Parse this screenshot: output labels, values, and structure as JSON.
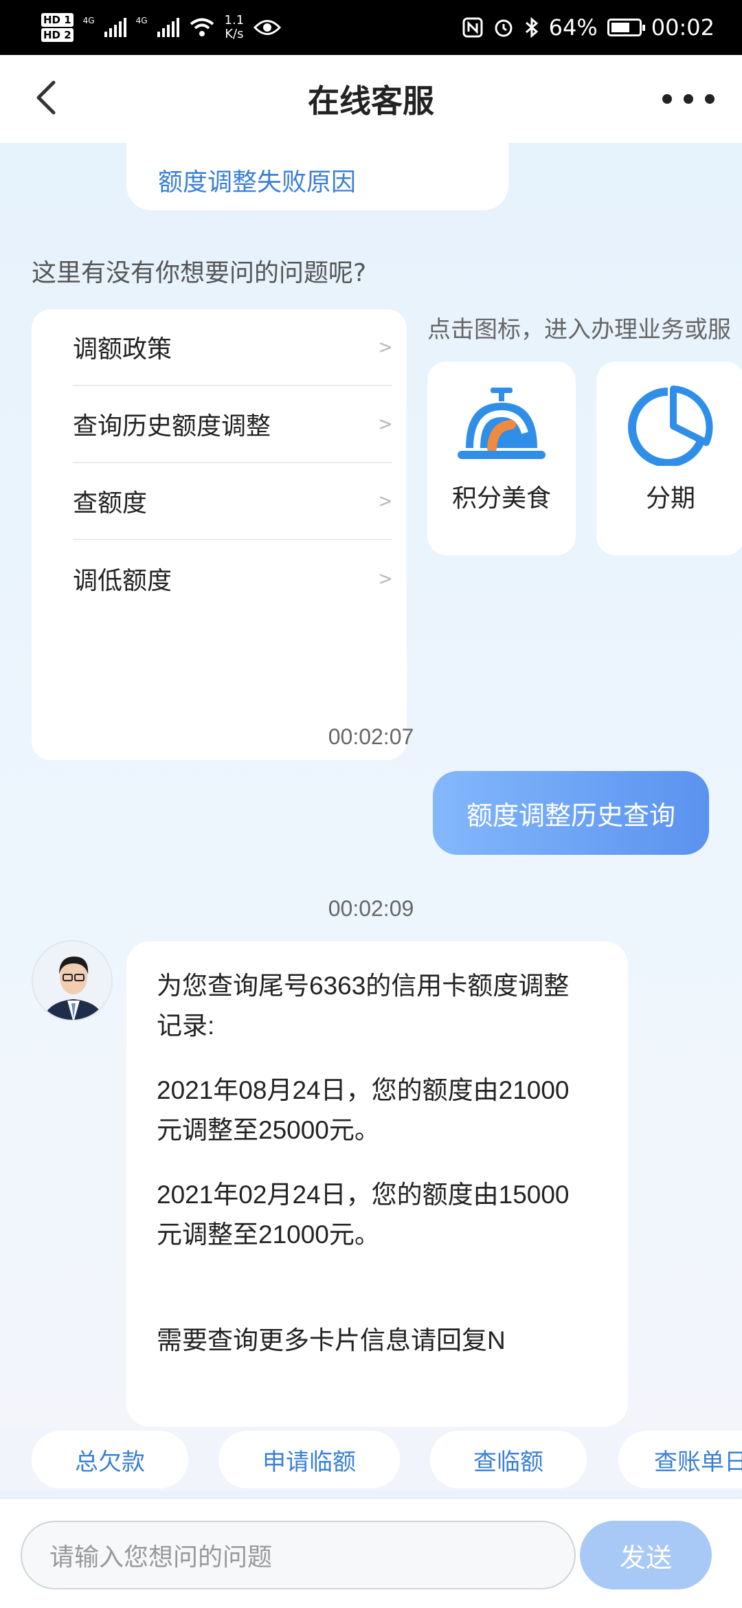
{
  "status_bar": {
    "hd1": "HD 1",
    "hd2": "HD 2",
    "net1": "4G",
    "net2": "4G",
    "speed_value": "1.1",
    "speed_unit": "K/s",
    "battery": "64%",
    "time": "00:02"
  },
  "nav": {
    "title": "在线客服"
  },
  "chat": {
    "prev_link": "额度调整失败原因",
    "question_prompt": "这里有没有你想要问的问题呢?",
    "faq_items": [
      "调额政策",
      "查询历史额度调整",
      "查额度",
      "调低额度"
    ],
    "chevron": ">",
    "service_hint": "点击图标，进入办理业务或服",
    "services": [
      {
        "label": "积分美食",
        "icon": "service-bell-icon"
      },
      {
        "label": "分期",
        "icon": "pie-chart-icon"
      }
    ],
    "timestamp_1": "00:02:07",
    "user_message": "额度调整历史查询",
    "timestamp_2": "00:02:09",
    "bot_message": {
      "line1": "为您查询尾号6363的信用卡额度调整",
      "line2": "记录:",
      "line3": "2021年08月24日，您的额度由21000",
      "line4": "元调整至25000元。",
      "line5": "2021年02月24日，您的额度由15000",
      "line6": "元调整至21000元。",
      "line7": "需要查询更多卡片信息请回复N"
    }
  },
  "quick_replies": [
    "总欠款",
    "申请临额",
    "查临额",
    "查账单日"
  ],
  "input": {
    "placeholder": "请输入您想问的问题",
    "send_label": "发送"
  },
  "colors": {
    "accent": "#3a7fd5",
    "user_bubble_start": "#83b8fb",
    "user_bubble_end": "#5a92ef",
    "send_button": "#a8c9f6",
    "bell_orange": "#f08a3e",
    "icon_blue": "#2f8fe8"
  }
}
